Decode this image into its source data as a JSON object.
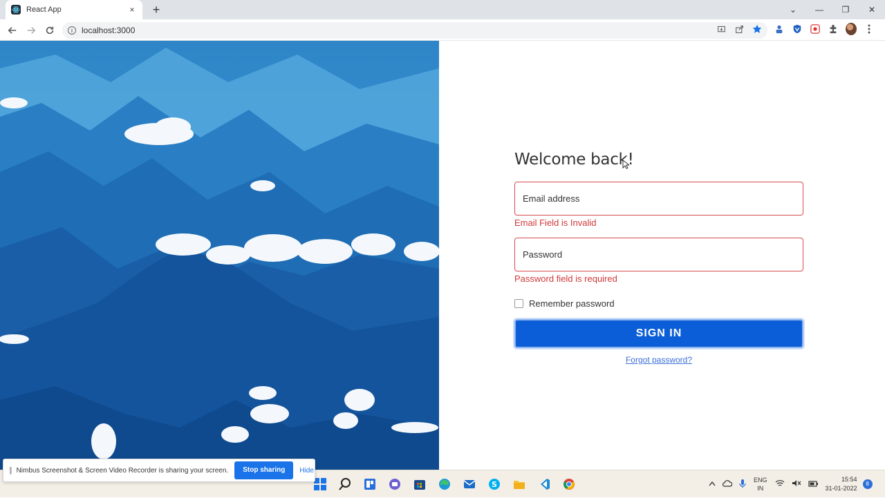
{
  "browser": {
    "tab_title": "React App",
    "tab_close": "×",
    "new_tab": "+",
    "url": "localhost:3000",
    "window_controls": {
      "dropdown": "⌄",
      "minimize": "—",
      "restore": "❐",
      "close": "✕"
    }
  },
  "login": {
    "heading": "Welcome back!",
    "email_placeholder": "Email address",
    "email_error": "Email Field is Invalid",
    "password_placeholder": "Password",
    "password_error": "Password field is required",
    "remember_label": "Remember password",
    "signin_label": "SIGN IN",
    "forgot_label": "Forgot password?"
  },
  "share_banner": {
    "message": "Nimbus Screenshot & Screen Video Recorder is sharing your screen.",
    "stop_label": "Stop sharing",
    "hide_label": "Hide"
  },
  "taskbar": {
    "lang_top": "ENG",
    "lang_bottom": "IN",
    "time": "15:54",
    "date": "31-01-2022",
    "notifications": "8"
  },
  "colors": {
    "primary": "#0b5ed7",
    "error": "#d03838",
    "link": "#3b6fd8"
  }
}
